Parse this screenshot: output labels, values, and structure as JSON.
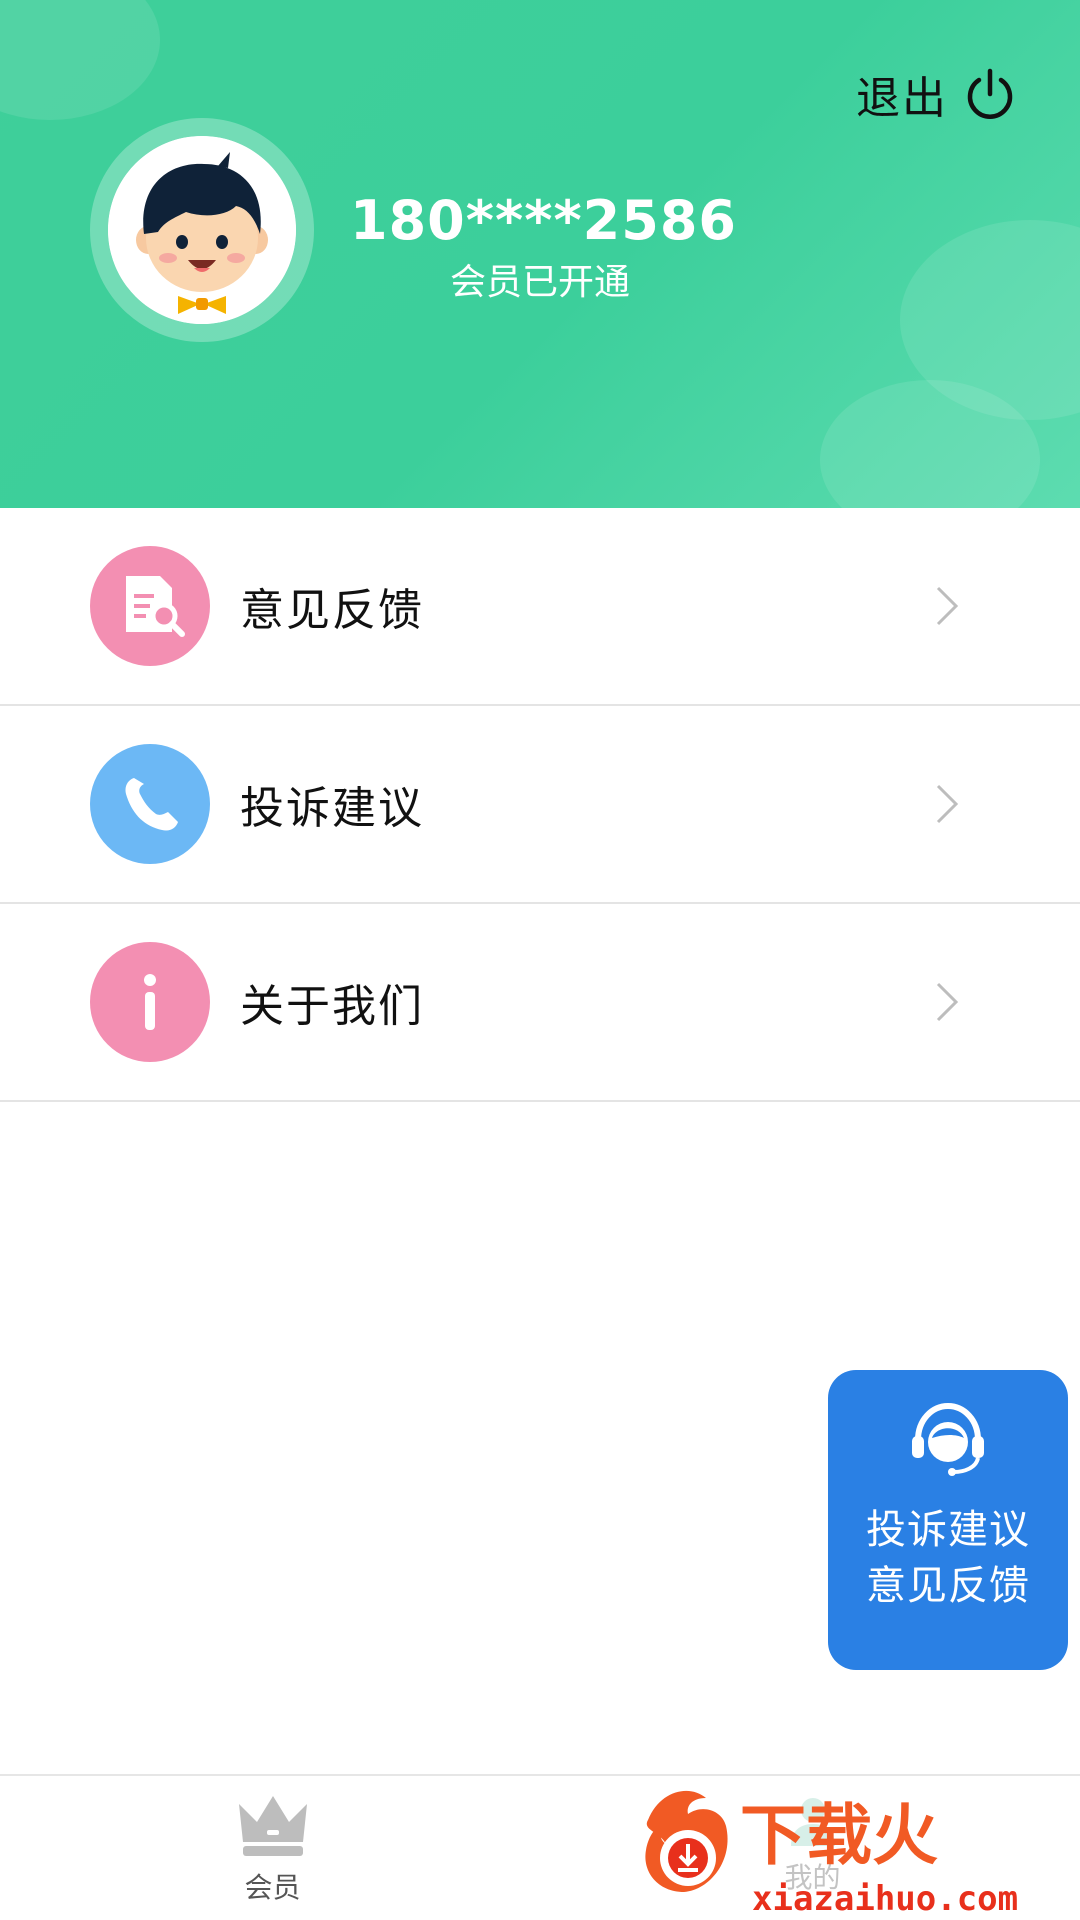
{
  "header": {
    "logout_label": "退出",
    "phone": "180****2586",
    "member_status": "会员已开通",
    "background_color": "#3fcf9a"
  },
  "menu": {
    "items": [
      {
        "label": "意见反馈",
        "icon": "document-search-icon",
        "icon_color": "#f38fb2"
      },
      {
        "label": "投诉建议",
        "icon": "phone-icon",
        "icon_color": "#6cb8f5"
      },
      {
        "label": "关于我们",
        "icon": "info-icon",
        "icon_color": "#f38fb2"
      }
    ]
  },
  "service_button": {
    "line1": "投诉建议",
    "line2": "意见反馈",
    "icon": "headset-agent-icon",
    "color": "#2a80e4"
  },
  "bottom_nav": {
    "items": [
      {
        "label": "会员",
        "icon": "crown-icon"
      },
      {
        "label": "我的",
        "icon": "user-icon"
      }
    ]
  },
  "watermark": {
    "brand": "下载火",
    "url": "xiazaihuo.com"
  }
}
